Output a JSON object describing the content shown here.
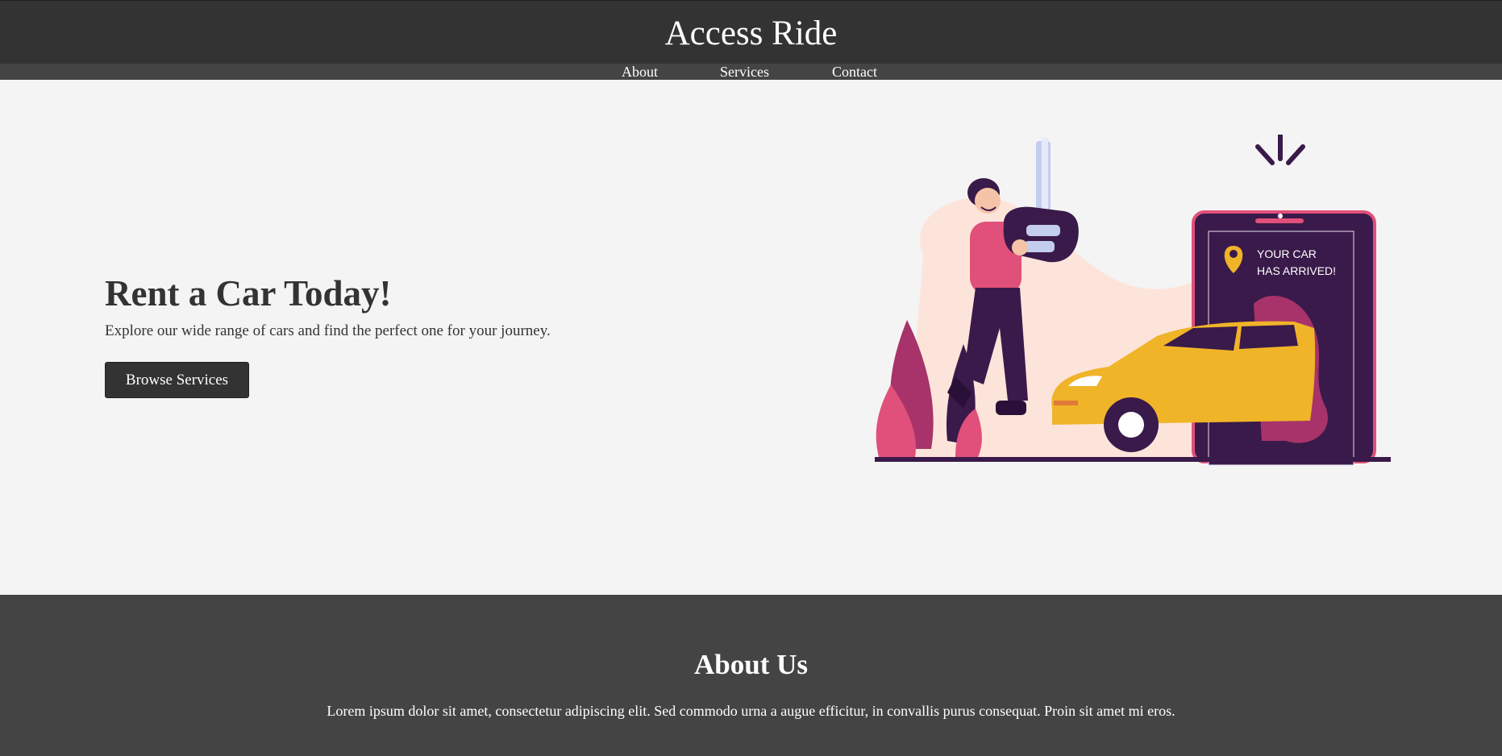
{
  "header": {
    "title": "Access Ride"
  },
  "nav": {
    "items": [
      {
        "label": "About"
      },
      {
        "label": "Services"
      },
      {
        "label": "Contact"
      }
    ]
  },
  "hero": {
    "title": "Rent a Car Today!",
    "subtitle": "Explore our wide range of cars and find the perfect one for your journey.",
    "button_label": "Browse Services",
    "illustration": {
      "phone_text_line1": "YOUR CAR",
      "phone_text_line2": "HAS ARRIVED!"
    }
  },
  "about": {
    "title": "About Us",
    "text": "Lorem ipsum dolor sit amet, consectetur adipiscing elit. Sed commodo urna a augue efficitur, in convallis purus consequat. Proin sit amet mi eros."
  },
  "colors": {
    "header_bg": "#333333",
    "nav_bg": "#444444",
    "page_bg": "#f4f4f4",
    "car_yellow": "#f0b429",
    "accent_pink": "#e0507a",
    "deep_purple": "#3a1a4a"
  }
}
